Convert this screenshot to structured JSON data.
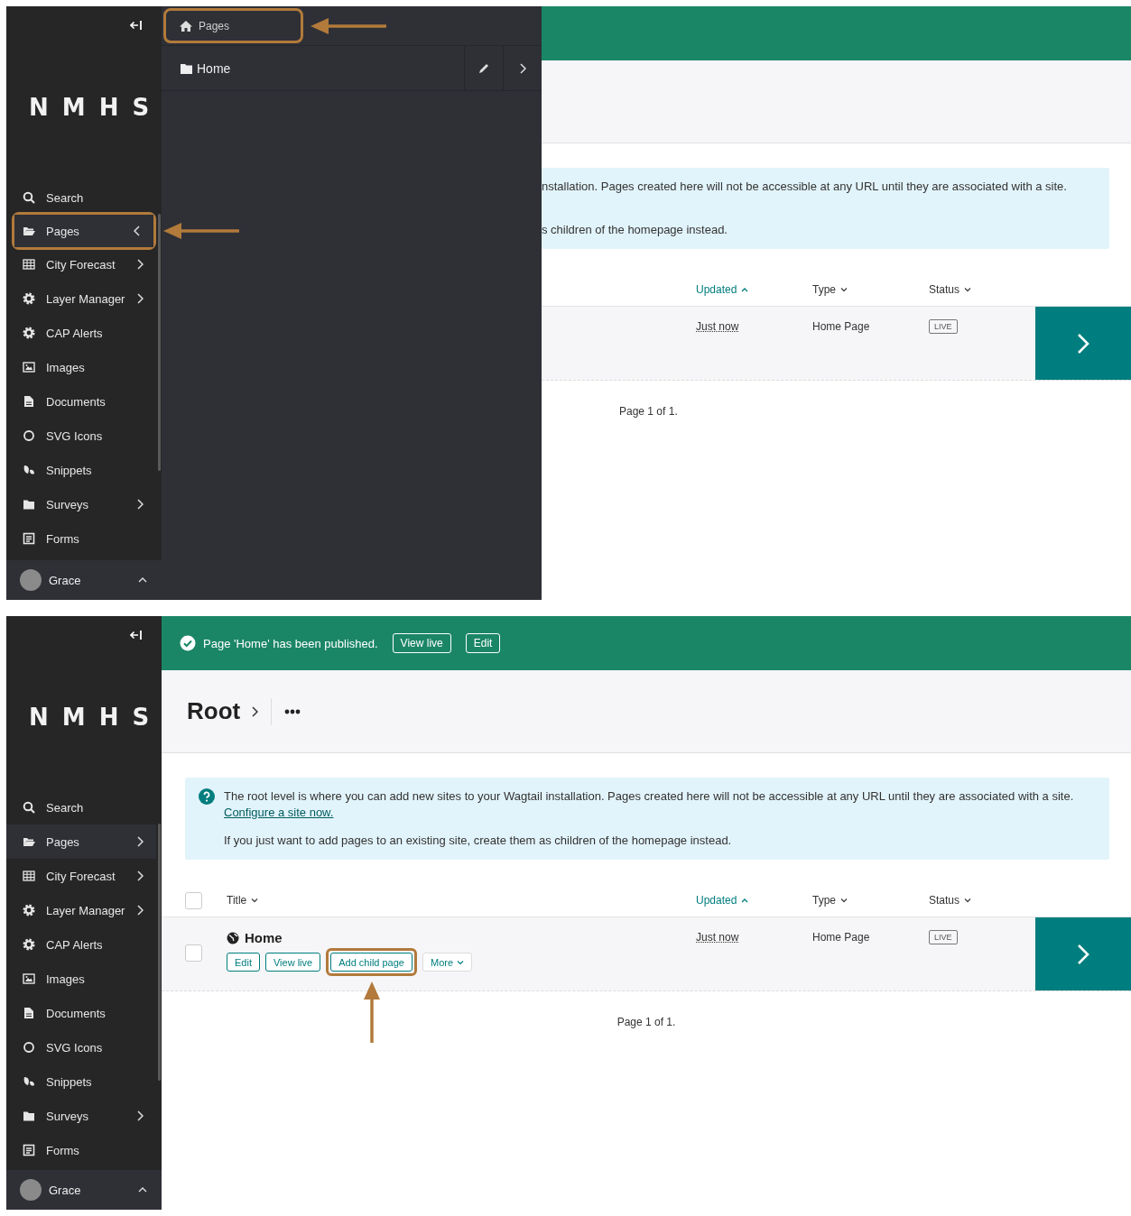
{
  "screens": [
    {
      "sidebar": {
        "logo": "N M H S",
        "items": [
          {
            "label": "Search",
            "selected": false,
            "highlighted": false
          },
          {
            "label": "Pages",
            "selected": true,
            "expanded": true,
            "highlighted": true,
            "arrow": {
              "kind": "from_right"
            }
          },
          {
            "label": "City Forecast",
            "selected": false,
            "expanded": false,
            "highlighted": false
          },
          {
            "label": "Layer Manager",
            "selected": false,
            "expanded": false,
            "highlighted": false
          },
          {
            "label": "CAP Alerts",
            "selected": false,
            "highlighted": false
          },
          {
            "label": "Images",
            "selected": false,
            "highlighted": false
          },
          {
            "label": "Documents",
            "selected": false,
            "highlighted": false
          },
          {
            "label": "SVG Icons",
            "selected": false,
            "highlighted": false
          },
          {
            "label": "Snippets",
            "selected": false,
            "highlighted": false
          },
          {
            "label": "Surveys",
            "selected": false,
            "expanded": false,
            "highlighted": false
          },
          {
            "label": "Forms",
            "selected": false,
            "highlighted": false
          }
        ],
        "user": "Grace"
      },
      "explorer": {
        "breadcrumb": {
          "label": "Pages",
          "highlighted": true,
          "arrow": {
            "kind": "from_right"
          }
        },
        "rows": [
          {
            "label": "Home"
          }
        ]
      },
      "main": {
        "kind": "partial",
        "info": {
          "paragraphs": [
            {
              "text": "nstallation. Pages created here will not be accessible at any URL until they are associated with a site."
            },
            {
              "text": "s children of the homepage instead."
            }
          ]
        },
        "table": {
          "columns": [
            {
              "label": "Updated",
              "kind": "date",
              "sorted": true
            },
            {
              "label": "Type",
              "kind": "text",
              "sorted": false
            },
            {
              "label": "Status",
              "kind": "badge",
              "sorted": false
            }
          ],
          "rows": [
            {
              "cells": [
                "Just now",
                "Home Page",
                "LIVE"
              ]
            }
          ]
        },
        "pagination": "Page 1 of 1."
      }
    },
    {
      "sidebar": {
        "logo": "N M H S",
        "items": [
          {
            "label": "Search",
            "selected": false,
            "highlighted": false
          },
          {
            "label": "Pages",
            "selected": true,
            "expanded": false,
            "highlighted": false
          },
          {
            "label": "City Forecast",
            "selected": false,
            "expanded": false,
            "highlighted": false
          },
          {
            "label": "Layer Manager",
            "selected": false,
            "expanded": false,
            "highlighted": false
          },
          {
            "label": "CAP Alerts",
            "selected": false,
            "highlighted": false
          },
          {
            "label": "Images",
            "selected": false,
            "highlighted": false
          },
          {
            "label": "Documents",
            "selected": false,
            "highlighted": false
          },
          {
            "label": "SVG Icons",
            "selected": false,
            "highlighted": false
          },
          {
            "label": "Snippets",
            "selected": false,
            "highlighted": false
          },
          {
            "label": "Surveys",
            "selected": false,
            "expanded": false,
            "highlighted": false
          },
          {
            "label": "Forms",
            "selected": false,
            "highlighted": false
          }
        ],
        "user": "Grace"
      },
      "main": {
        "kind": "full",
        "banner": {
          "message": "Page 'Home' has been published.",
          "buttons": [
            "View live",
            "Edit"
          ]
        },
        "title": "Root",
        "info": {
          "paragraphs": [
            {
              "text": "The root level is where you can add new sites to your Wagtail installation. Pages created here will not be accessible at any URL until they are associated with a site.",
              "link": "Configure a site now."
            },
            {
              "text": "If you just want to add pages to an existing site, create them as children of the homepage instead."
            }
          ]
        },
        "table": {
          "select_all": {
            "checked": false
          },
          "columns": [
            {
              "label": "Title",
              "kind": "title",
              "sorted": false
            },
            {
              "label": "Updated",
              "kind": "date",
              "sorted": true
            },
            {
              "label": "Type",
              "kind": "text",
              "sorted": false
            },
            {
              "label": "Status",
              "kind": "badge",
              "sorted": false
            }
          ],
          "rows": [
            {
              "checked": false,
              "cells": [
                "Home",
                "Just now",
                "Home Page",
                "LIVE"
              ],
              "actions": [
                {
                  "label": "Edit",
                  "highlighted": false
                },
                {
                  "label": "View live",
                  "highlighted": false
                },
                {
                  "label": "Add child page",
                  "highlighted": true,
                  "arrow": {
                    "kind": "from_below"
                  }
                },
                {
                  "label": "More",
                  "kind": "dropdown",
                  "highlighted": false
                }
              ]
            }
          ]
        },
        "pagination": "Page 1 of 1."
      }
    }
  ]
}
